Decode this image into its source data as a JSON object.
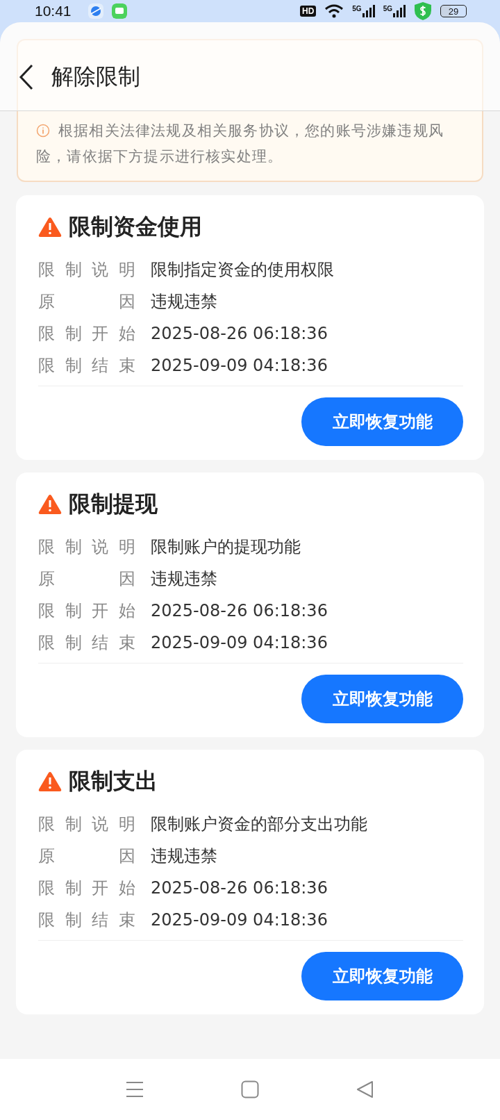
{
  "status_bar": {
    "time": "10:41",
    "hd_label": "HD",
    "network_labels": [
      "5G",
      "5G"
    ],
    "battery": "29"
  },
  "header": {
    "title": "解除限制"
  },
  "notice": {
    "text": "根据相关法律法规及相关服务协议，您的账号涉嫌违规风险，请依据下方提示进行核实处理。"
  },
  "cards": [
    {
      "title": "限制资金使用",
      "rows": [
        {
          "label": "限制说明",
          "value": "限制指定资金的使用权限"
        },
        {
          "label": "原因",
          "value": "违规违禁"
        },
        {
          "label": "限制开始",
          "value": "2025-08-26 06:18:36"
        },
        {
          "label": "限制结束",
          "value": "2025-09-09 04:18:36"
        }
      ],
      "button": "立即恢复功能"
    },
    {
      "title": "限制提现",
      "rows": [
        {
          "label": "限制说明",
          "value": "限制账户的提现功能"
        },
        {
          "label": "原因",
          "value": "违规违禁"
        },
        {
          "label": "限制开始",
          "value": "2025-08-26 06:18:36"
        },
        {
          "label": "限制结束",
          "value": "2025-09-09 04:18:36"
        }
      ],
      "button": "立即恢复功能"
    },
    {
      "title": "限制支出",
      "rows": [
        {
          "label": "限制说明",
          "value": "限制账户资金的部分支出功能"
        },
        {
          "label": "原因",
          "value": "违规违禁"
        },
        {
          "label": "限制开始",
          "value": "2025-08-26 06:18:36"
        },
        {
          "label": "限制结束",
          "value": "2025-09-09 04:18:36"
        }
      ],
      "button": "立即恢复功能"
    }
  ]
}
